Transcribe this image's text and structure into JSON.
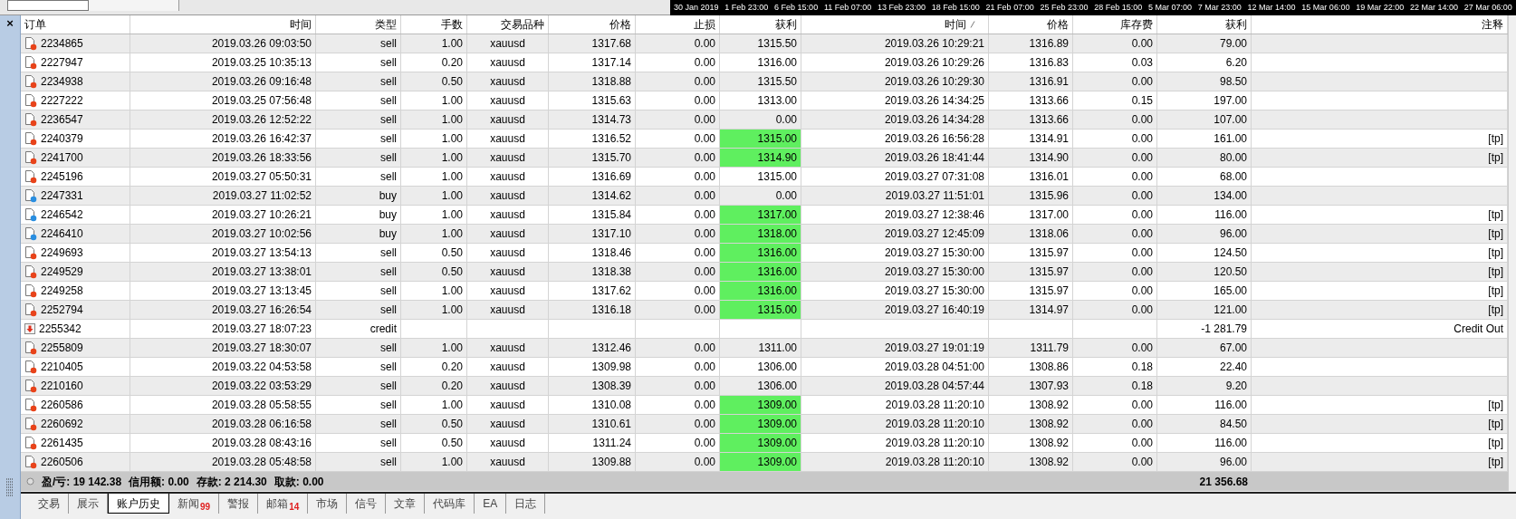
{
  "chart_axis": {
    "labels": [
      "30 Jan 2019",
      "1 Feb 23:00",
      "6 Feb 15:00",
      "11 Feb 07:00",
      "13 Feb 23:00",
      "18 Feb 15:00",
      "21 Feb 07:00",
      "25 Feb 23:00",
      "28 Feb 15:00",
      "5 Mar 07:00",
      "7 Mar 23:00",
      "12 Mar 14:00",
      "15 Mar 06:00",
      "19 Mar 22:00",
      "22 Mar 14:00",
      "27 Mar 06:00"
    ]
  },
  "close_button": "×",
  "table": {
    "columns": [
      {
        "label": "订单",
        "sorted": false
      },
      {
        "label": "时间",
        "sorted": false
      },
      {
        "label": "类型",
        "sorted": false
      },
      {
        "label": "手数",
        "sorted": false
      },
      {
        "label": "交易品种",
        "sorted": false
      },
      {
        "label": "价格",
        "sorted": false
      },
      {
        "label": "止损",
        "sorted": false
      },
      {
        "label": "获利",
        "sorted": false
      },
      {
        "label": "时间",
        "sorted": true
      },
      {
        "label": "价格",
        "sorted": false
      },
      {
        "label": "库存费",
        "sorted": false
      },
      {
        "label": "获利",
        "sorted": false
      },
      {
        "label": "注释",
        "sorted": false
      }
    ],
    "rows": [
      {
        "kind": "sell",
        "order": "2234865",
        "open_time": "2019.03.26 09:03:50",
        "type": "sell",
        "lots": "1.00",
        "symbol": "xauusd",
        "open_price": "1317.68",
        "sl": "0.00",
        "tp": "1315.50",
        "tp_hit": false,
        "close_time": "2019.03.26 10:29:21",
        "close_price": "1316.89",
        "swap": "0.00",
        "profit": "79.00"
      },
      {
        "kind": "sell",
        "order": "2227947",
        "open_time": "2019.03.25 10:35:13",
        "type": "sell",
        "lots": "0.20",
        "symbol": "xauusd",
        "open_price": "1317.14",
        "sl": "0.00",
        "tp": "1316.00",
        "tp_hit": false,
        "close_time": "2019.03.26 10:29:26",
        "close_price": "1316.83",
        "swap": "0.03",
        "profit": "6.20"
      },
      {
        "kind": "sell",
        "order": "2234938",
        "open_time": "2019.03.26 09:16:48",
        "type": "sell",
        "lots": "0.50",
        "symbol": "xauusd",
        "open_price": "1318.88",
        "sl": "0.00",
        "tp": "1315.50",
        "tp_hit": false,
        "close_time": "2019.03.26 10:29:30",
        "close_price": "1316.91",
        "swap": "0.00",
        "profit": "98.50"
      },
      {
        "kind": "sell",
        "order": "2227222",
        "open_time": "2019.03.25 07:56:48",
        "type": "sell",
        "lots": "1.00",
        "symbol": "xauusd",
        "open_price": "1315.63",
        "sl": "0.00",
        "tp": "1313.00",
        "tp_hit": false,
        "close_time": "2019.03.26 14:34:25",
        "close_price": "1313.66",
        "swap": "0.15",
        "profit": "197.00"
      },
      {
        "kind": "sell",
        "order": "2236547",
        "open_time": "2019.03.26 12:52:22",
        "type": "sell",
        "lots": "1.00",
        "symbol": "xauusd",
        "open_price": "1314.73",
        "sl": "0.00",
        "tp": "0.00",
        "tp_hit": false,
        "close_time": "2019.03.26 14:34:28",
        "close_price": "1313.66",
        "swap": "0.00",
        "profit": "107.00"
      },
      {
        "kind": "sell",
        "order": "2240379",
        "open_time": "2019.03.26 16:42:37",
        "type": "sell",
        "lots": "1.00",
        "symbol": "xauusd",
        "open_price": "1316.52",
        "sl": "0.00",
        "tp": "1315.00",
        "tp_hit": true,
        "close_time": "2019.03.26 16:56:28",
        "close_price": "1314.91",
        "swap": "0.00",
        "profit": "161.00",
        "comment": "[tp]"
      },
      {
        "kind": "sell",
        "order": "2241700",
        "open_time": "2019.03.26 18:33:56",
        "type": "sell",
        "lots": "1.00",
        "symbol": "xauusd",
        "open_price": "1315.70",
        "sl": "0.00",
        "tp": "1314.90",
        "tp_hit": true,
        "close_time": "2019.03.26 18:41:44",
        "close_price": "1314.90",
        "swap": "0.00",
        "profit": "80.00",
        "comment": "[tp]"
      },
      {
        "kind": "sell",
        "order": "2245196",
        "open_time": "2019.03.27 05:50:31",
        "type": "sell",
        "lots": "1.00",
        "symbol": "xauusd",
        "open_price": "1316.69",
        "sl": "0.00",
        "tp": "1315.00",
        "tp_hit": false,
        "close_time": "2019.03.27 07:31:08",
        "close_price": "1316.01",
        "swap": "0.00",
        "profit": "68.00"
      },
      {
        "kind": "buy",
        "order": "2247331",
        "open_time": "2019.03.27 11:02:52",
        "type": "buy",
        "lots": "1.00",
        "symbol": "xauusd",
        "open_price": "1314.62",
        "sl": "0.00",
        "tp": "0.00",
        "tp_hit": false,
        "close_time": "2019.03.27 11:51:01",
        "close_price": "1315.96",
        "swap": "0.00",
        "profit": "134.00"
      },
      {
        "kind": "buy",
        "order": "2246542",
        "open_time": "2019.03.27 10:26:21",
        "type": "buy",
        "lots": "1.00",
        "symbol": "xauusd",
        "open_price": "1315.84",
        "sl": "0.00",
        "tp": "1317.00",
        "tp_hit": true,
        "close_time": "2019.03.27 12:38:46",
        "close_price": "1317.00",
        "swap": "0.00",
        "profit": "116.00",
        "comment": "[tp]"
      },
      {
        "kind": "buy",
        "order": "2246410",
        "open_time": "2019.03.27 10:02:56",
        "type": "buy",
        "lots": "1.00",
        "symbol": "xauusd",
        "open_price": "1317.10",
        "sl": "0.00",
        "tp": "1318.00",
        "tp_hit": true,
        "close_time": "2019.03.27 12:45:09",
        "close_price": "1318.06",
        "swap": "0.00",
        "profit": "96.00",
        "comment": "[tp]"
      },
      {
        "kind": "sell",
        "order": "2249693",
        "open_time": "2019.03.27 13:54:13",
        "type": "sell",
        "lots": "0.50",
        "symbol": "xauusd",
        "open_price": "1318.46",
        "sl": "0.00",
        "tp": "1316.00",
        "tp_hit": true,
        "close_time": "2019.03.27 15:30:00",
        "close_price": "1315.97",
        "swap": "0.00",
        "profit": "124.50",
        "comment": "[tp]"
      },
      {
        "kind": "sell",
        "order": "2249529",
        "open_time": "2019.03.27 13:38:01",
        "type": "sell",
        "lots": "0.50",
        "symbol": "xauusd",
        "open_price": "1318.38",
        "sl": "0.00",
        "tp": "1316.00",
        "tp_hit": true,
        "close_time": "2019.03.27 15:30:00",
        "close_price": "1315.97",
        "swap": "0.00",
        "profit": "120.50",
        "comment": "[tp]"
      },
      {
        "kind": "sell",
        "order": "2249258",
        "open_time": "2019.03.27 13:13:45",
        "type": "sell",
        "lots": "1.00",
        "symbol": "xauusd",
        "open_price": "1317.62",
        "sl": "0.00",
        "tp": "1316.00",
        "tp_hit": true,
        "close_time": "2019.03.27 15:30:00",
        "close_price": "1315.97",
        "swap": "0.00",
        "profit": "165.00",
        "comment": "[tp]"
      },
      {
        "kind": "sell",
        "order": "2252794",
        "open_time": "2019.03.27 16:26:54",
        "type": "sell",
        "lots": "1.00",
        "symbol": "xauusd",
        "open_price": "1316.18",
        "sl": "0.00",
        "tp": "1315.00",
        "tp_hit": true,
        "close_time": "2019.03.27 16:40:19",
        "close_price": "1314.97",
        "swap": "0.00",
        "profit": "121.00",
        "comment": "[tp]"
      },
      {
        "kind": "credit",
        "order": "2255342",
        "open_time": "2019.03.27 18:07:23",
        "type": "credit",
        "tp_hit": false,
        "profit": "-1 281.79",
        "comment": "Credit Out"
      },
      {
        "kind": "sell",
        "order": "2255809",
        "open_time": "2019.03.27 18:30:07",
        "type": "sell",
        "lots": "1.00",
        "symbol": "xauusd",
        "open_price": "1312.46",
        "sl": "0.00",
        "tp": "1311.00",
        "tp_hit": false,
        "close_time": "2019.03.27 19:01:19",
        "close_price": "1311.79",
        "swap": "0.00",
        "profit": "67.00"
      },
      {
        "kind": "sell",
        "order": "2210405",
        "open_time": "2019.03.22 04:53:58",
        "type": "sell",
        "lots": "0.20",
        "symbol": "xauusd",
        "open_price": "1309.98",
        "sl": "0.00",
        "tp": "1306.00",
        "tp_hit": false,
        "close_time": "2019.03.28 04:51:00",
        "close_price": "1308.86",
        "swap": "0.18",
        "profit": "22.40"
      },
      {
        "kind": "sell",
        "order": "2210160",
        "open_time": "2019.03.22 03:53:29",
        "type": "sell",
        "lots": "0.20",
        "symbol": "xauusd",
        "open_price": "1308.39",
        "sl": "0.00",
        "tp": "1306.00",
        "tp_hit": false,
        "close_time": "2019.03.28 04:57:44",
        "close_price": "1307.93",
        "swap": "0.18",
        "profit": "9.20"
      },
      {
        "kind": "sell",
        "order": "2260586",
        "open_time": "2019.03.28 05:58:55",
        "type": "sell",
        "lots": "1.00",
        "symbol": "xauusd",
        "open_price": "1310.08",
        "sl": "0.00",
        "tp": "1309.00",
        "tp_hit": true,
        "close_time": "2019.03.28 11:20:10",
        "close_price": "1308.92",
        "swap": "0.00",
        "profit": "116.00",
        "comment": "[tp]"
      },
      {
        "kind": "sell",
        "order": "2260692",
        "open_time": "2019.03.28 06:16:58",
        "type": "sell",
        "lots": "0.50",
        "symbol": "xauusd",
        "open_price": "1310.61",
        "sl": "0.00",
        "tp": "1309.00",
        "tp_hit": true,
        "close_time": "2019.03.28 11:20:10",
        "close_price": "1308.92",
        "swap": "0.00",
        "profit": "84.50",
        "comment": "[tp]"
      },
      {
        "kind": "sell",
        "order": "2261435",
        "open_time": "2019.03.28 08:43:16",
        "type": "sell",
        "lots": "0.50",
        "symbol": "xauusd",
        "open_price": "1311.24",
        "sl": "0.00",
        "tp": "1309.00",
        "tp_hit": true,
        "close_time": "2019.03.28 11:20:10",
        "close_price": "1308.92",
        "swap": "0.00",
        "profit": "116.00",
        "comment": "[tp]"
      },
      {
        "kind": "sell",
        "order": "2260506",
        "open_time": "2019.03.28 05:48:58",
        "type": "sell",
        "lots": "1.00",
        "symbol": "xauusd",
        "open_price": "1309.88",
        "sl": "0.00",
        "tp": "1309.00",
        "tp_hit": true,
        "close_time": "2019.03.28 11:20:10",
        "close_price": "1308.92",
        "swap": "0.00",
        "profit": "96.00",
        "comment": "[tp]"
      }
    ],
    "summary": {
      "items": [
        "盈/亏: 19 142.38",
        "信用额: 0.00",
        "存款: 2 214.30",
        "取款: 0.00"
      ],
      "total_profit": "21 356.68"
    }
  },
  "tabs": [
    {
      "label": "交易",
      "selected": false
    },
    {
      "label": "展示",
      "selected": false
    },
    {
      "label": "账户历史",
      "selected": true
    },
    {
      "label": "新闻",
      "selected": false,
      "badge": "99"
    },
    {
      "label": "警报",
      "selected": false
    },
    {
      "label": "邮箱",
      "selected": false,
      "badge": "14"
    },
    {
      "label": "市场",
      "selected": false
    },
    {
      "label": "信号",
      "selected": false
    },
    {
      "label": "文章",
      "selected": false
    },
    {
      "label": "代码库",
      "selected": false
    },
    {
      "label": "EA",
      "selected": false
    },
    {
      "label": "日志",
      "selected": false
    }
  ]
}
